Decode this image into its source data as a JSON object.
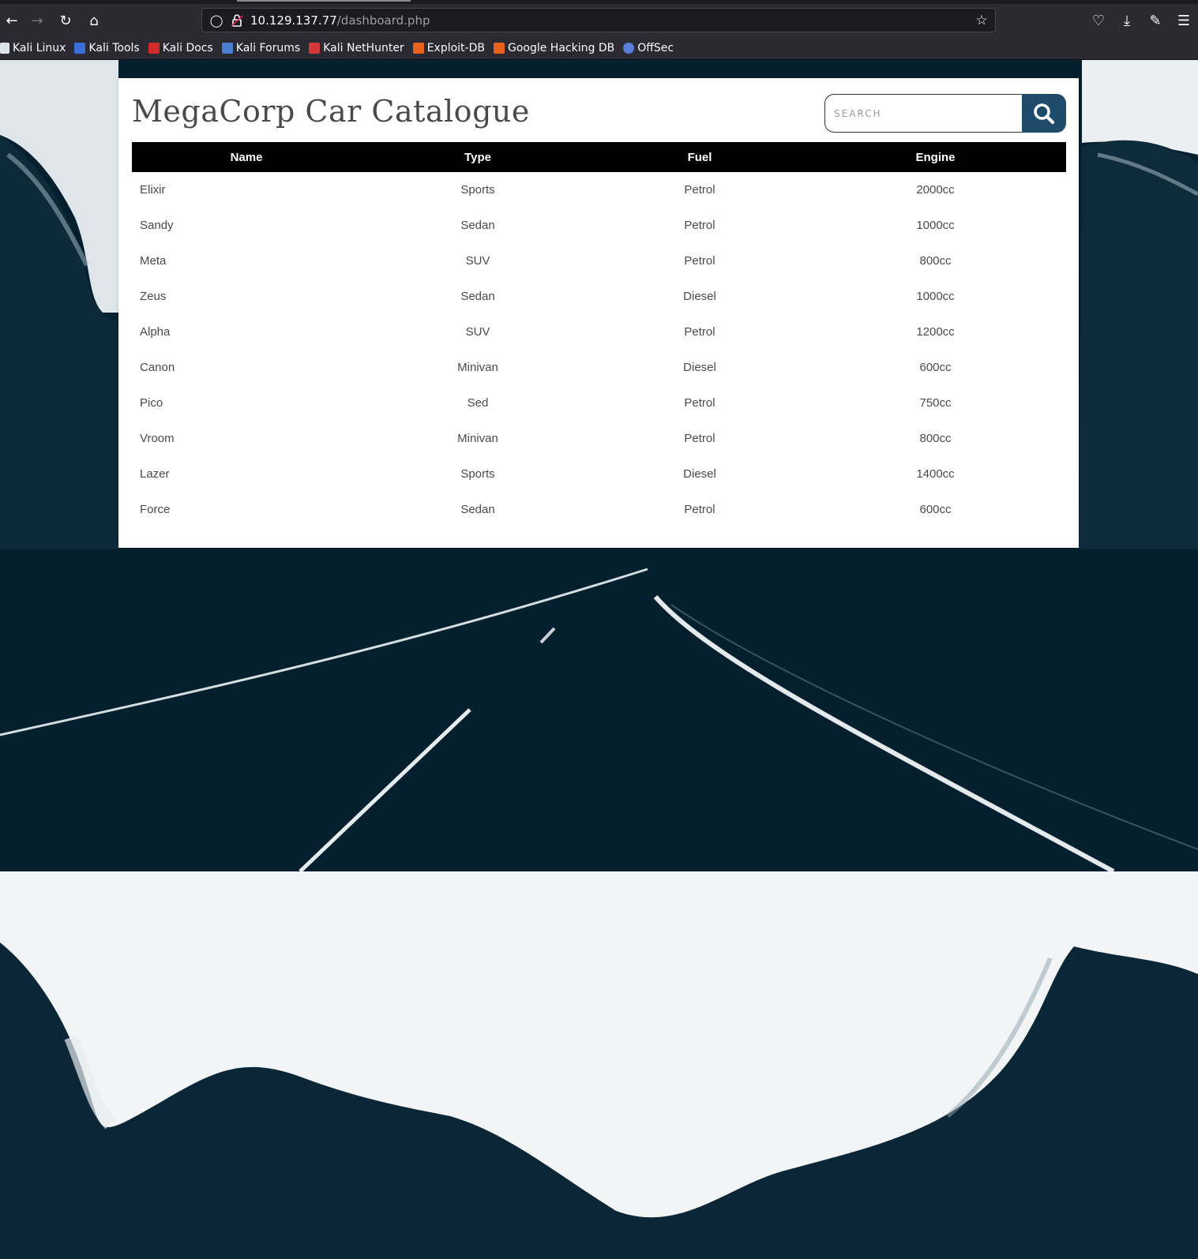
{
  "browser": {
    "url_host": "10.129.137.77",
    "url_path": "/dashboard.php",
    "bookmarks": [
      {
        "label": "Kali Linux",
        "icon": "kali-dragon-icon",
        "color": "#2d7bd6"
      },
      {
        "label": "Kali Tools",
        "icon": "kali-tools-icon",
        "color": "#3a6fd8"
      },
      {
        "label": "Kali Docs",
        "icon": "kali-docs-icon",
        "color": "#d22b2b"
      },
      {
        "label": "Kali Forums",
        "icon": "kali-forums-icon",
        "color": "#4a7fd0"
      },
      {
        "label": "Kali NetHunter",
        "icon": "kali-nethunter-icon",
        "color": "#d23a3a"
      },
      {
        "label": "Exploit-DB",
        "icon": "exploit-db-icon",
        "color": "#e8621a"
      },
      {
        "label": "Google Hacking DB",
        "icon": "ghdb-icon",
        "color": "#e8621a"
      },
      {
        "label": "OffSec",
        "icon": "offsec-icon",
        "color": "#5a7fd8"
      }
    ]
  },
  "page": {
    "title": "MegaCorp Car Catalogue",
    "search": {
      "placeholder": "SEARCH"
    },
    "table": {
      "headers": [
        "Name",
        "Type",
        "Fuel",
        "Engine"
      ],
      "rows": [
        [
          "Elixir",
          "Sports",
          "Petrol",
          "2000cc"
        ],
        [
          "Sandy",
          "Sedan",
          "Petrol",
          "1000cc"
        ],
        [
          "Meta",
          "SUV",
          "Petrol",
          "800cc"
        ],
        [
          "Zeus",
          "Sedan",
          "Diesel",
          "1000cc"
        ],
        [
          "Alpha",
          "SUV",
          "Petrol",
          "1200cc"
        ],
        [
          "Canon",
          "Minivan",
          "Diesel",
          "600cc"
        ],
        [
          "Pico",
          "Sed",
          "Petrol",
          "750cc"
        ],
        [
          "Vroom",
          "Minivan",
          "Petrol",
          "800cc"
        ],
        [
          "Lazer",
          "Sports",
          "Diesel",
          "1400cc"
        ],
        [
          "Force",
          "Sedan",
          "Petrol",
          "600cc"
        ]
      ]
    }
  },
  "colors": {
    "search_button": "#1f4b6b",
    "table_header": "#000000",
    "background_dark": "#04202f"
  }
}
